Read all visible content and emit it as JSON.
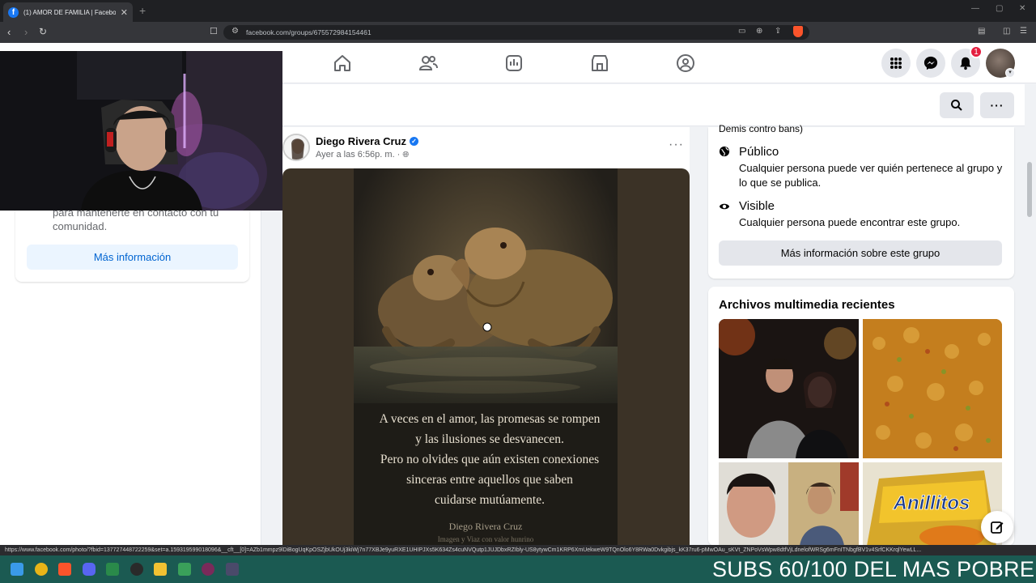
{
  "browser": {
    "tab_title": "(1) AMOR DE FAMILIA | Faceboo",
    "tab_close": "✕",
    "new_tab": "+",
    "url": "facebook.com/groups/675572984154461"
  },
  "group_about": {
    "cut_text": "Demis contro bans)",
    "public_title": "Público",
    "public_desc": "Cualquier persona puede ver quién pertenece al grupo y lo que se publica.",
    "visible_title": "Visible",
    "visible_desc": "Cualquier persona puede encontrar este grupo.",
    "more_button": "Más información sobre este grupo"
  },
  "left_card": {
    "text": "para mantenerte en contacto con tu comunidad.",
    "button": "Más información"
  },
  "post": {
    "author": "Diego Rivera Cruz",
    "time": "Ayer a las 6:56p. m. ·",
    "more": "···",
    "quote_lines": [
      "A veces en el amor, las promesas se rompen",
      "y las ilusiones se desvanecen.",
      "Pero no olvides que aún existen conexiones",
      "sinceras entre aquellos que saben",
      "cuidarse mutúamente."
    ],
    "quote_author": "Diego Rivera Cruz",
    "quote_credit": "Imagen y Viaz con valor hunrino"
  },
  "media": {
    "title": "Archivos multimedia recientes",
    "thumb4_text": "Anillitos"
  },
  "notifications": {
    "badge": "1"
  },
  "status_url": "https://www.facebook.com/photo/?fbid=137727448722259&set=a.159319599018096&__cft__[0]=AZb1mmpz9lDiBogUqKpOSZjbUkOUj3kiWj7n77XBJe9yuRXE1UHIPJXs5K634Zs4cuNVQutp1JUJDbxRZIbly-US8ytywCm1KRP6XmUekweW9TQnOlo6Y8RWa0Dvkgibjs_kK37ru6-pMwOAu_sKVt_ZNPoVsWpw8dtfVjLdnelofWRSg6mFnITNbgfBV1v4SrfCKKrqlYewLL...",
  "overlay": {
    "text": "SUBS 60/100 DEL MAS POBRE"
  },
  "colors": {
    "fb_blue": "#1877f2",
    "badge_red": "#e41e3f",
    "taskbar": "#1b5a52"
  }
}
